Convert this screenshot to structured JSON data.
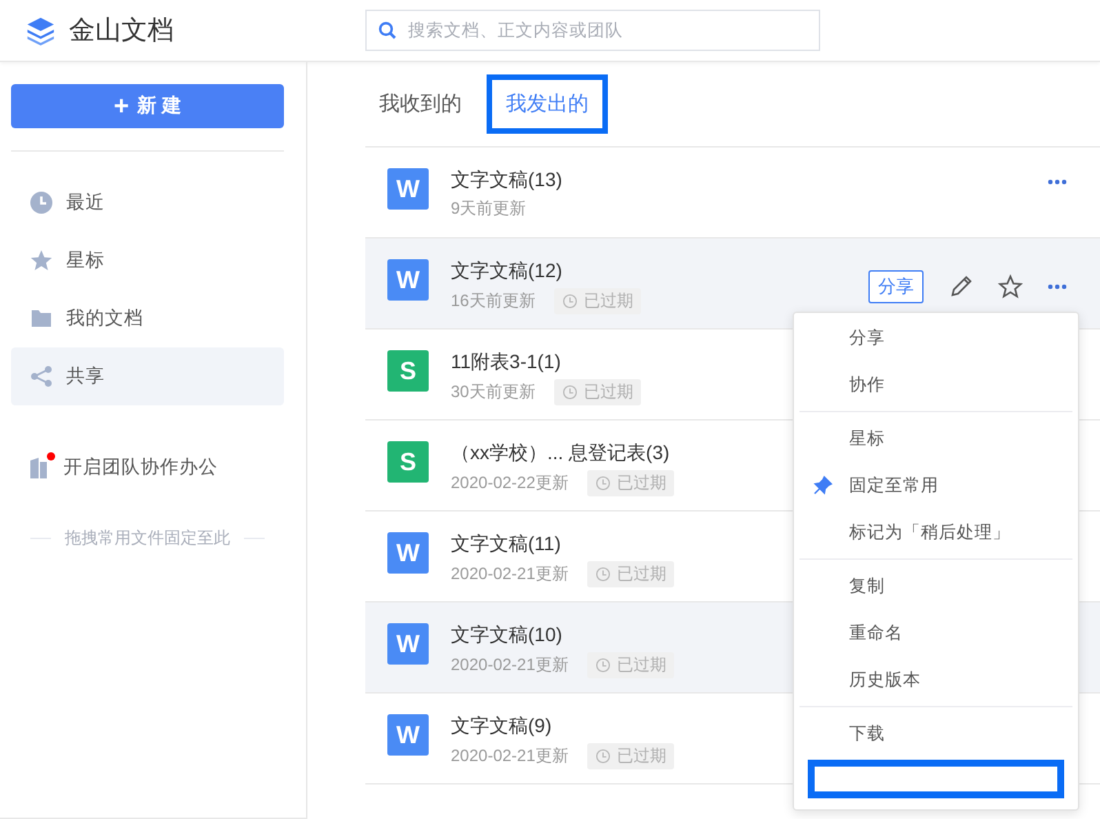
{
  "header": {
    "app_name": "金山文档",
    "search": {
      "placeholder": "搜索文档、正文内容或团队"
    }
  },
  "sidebar": {
    "new_button": {
      "icon": "+",
      "label": "新 建"
    },
    "items": [
      {
        "kind": "clock",
        "label": "最近",
        "selected": false
      },
      {
        "kind": "star",
        "label": "星标",
        "selected": false
      },
      {
        "kind": "folder",
        "label": "我的文档",
        "selected": false
      },
      {
        "kind": "share",
        "label": "共享",
        "selected": true
      }
    ],
    "team": {
      "label": "开启团队协作办公",
      "notification_dot": true
    },
    "drop_hint": "拖拽常用文件固定至此"
  },
  "tabs": [
    {
      "label": "我收到的",
      "selected": false
    },
    {
      "label": "我发出的",
      "selected": true
    }
  ],
  "files": [
    {
      "kind": "doc",
      "badge": "W",
      "title": "文字文稿(13)",
      "updated": "9天前更新",
      "expired": false,
      "highlighted": false
    },
    {
      "kind": "doc",
      "badge": "W",
      "title": "文字文稿(12)",
      "updated": "16天前更新",
      "expired": true,
      "tag": "已过期",
      "highlighted": true,
      "share_button": "分享"
    },
    {
      "kind": "sheet",
      "badge": "S",
      "title": "11附表3-1(1)",
      "updated": "30天前更新",
      "expired": true,
      "tag": "已过期",
      "highlighted": false
    },
    {
      "kind": "sheet",
      "badge": "S",
      "title": "（xx学校）... 息登记表(3)",
      "updated": "2020-02-22更新",
      "expired": true,
      "tag": "已过期",
      "highlighted": false
    },
    {
      "kind": "doc",
      "badge": "W",
      "title": "文字文稿(11)",
      "updated": "2020-02-21更新",
      "expired": true,
      "tag": "已过期",
      "highlighted": false
    },
    {
      "kind": "doc",
      "badge": "W",
      "title": "文字文稿(10)",
      "updated": "2020-02-21更新",
      "expired": true,
      "tag": "已过期",
      "highlighted": true
    },
    {
      "kind": "doc",
      "badge": "W",
      "title": "文字文稿(9)",
      "updated": "2020-02-21更新",
      "expired": true,
      "tag": "已过期",
      "highlighted": false
    }
  ],
  "context_menu": {
    "groups": [
      [
        {
          "label": "分享",
          "pinned": false
        },
        {
          "label": "协作",
          "pinned": false
        }
      ],
      [
        {
          "label": "星标",
          "pinned": false
        },
        {
          "label": "固定至常用",
          "pinned": true
        },
        {
          "label": "标记为「稍后处理」",
          "pinned": false
        }
      ],
      [
        {
          "label": "复制",
          "pinned": false
        },
        {
          "label": "重命名",
          "pinned": false
        },
        {
          "label": "历史版本",
          "pinned": false
        }
      ],
      [
        {
          "label": "下载",
          "pinned": false
        }
      ]
    ]
  }
}
